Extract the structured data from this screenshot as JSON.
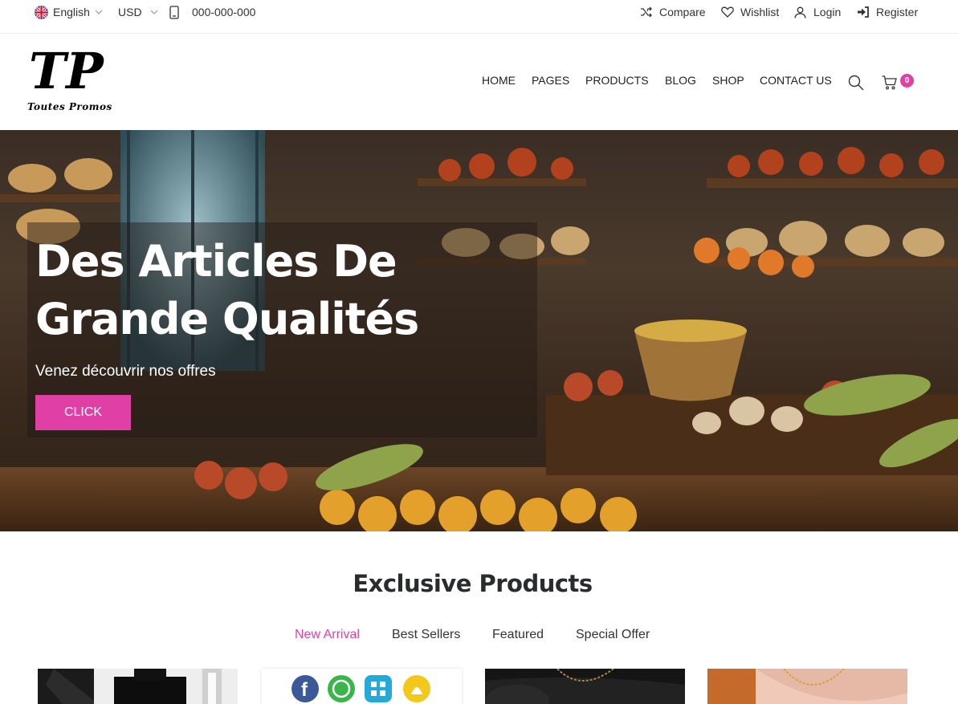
{
  "topbar": {
    "language": "English",
    "currency": "USD",
    "phone": "000-000-000",
    "compare": "Compare",
    "wishlist": "Wishlist",
    "login": "Login",
    "register": "Register"
  },
  "header": {
    "logo_mark": "TP",
    "logo_text": "Toutes Promos",
    "nav": [
      "HOME",
      "PAGES",
      "PRODUCTS",
      "BLOG",
      "SHOP",
      "CONTACT US"
    ],
    "cart_count": "0"
  },
  "hero": {
    "title_line1": "Des Articles De",
    "title_line2": "Grande Qualités",
    "subtitle": "Venez découvrir nos offres",
    "button": "CLICK"
  },
  "products": {
    "title": "Exclusive Products",
    "tabs": [
      "New Arrival",
      "Best Sellers",
      "Featured",
      "Special Offer"
    ],
    "active_tab": "New Arrival"
  },
  "colors": {
    "accent": "#e040a6",
    "text": "#292b2c"
  },
  "icons": [
    "uk-flag-icon",
    "chevron-down-icon",
    "mobile-phone-icon",
    "shuffle-icon",
    "heart-icon",
    "user-icon",
    "sign-in-icon",
    "search-icon",
    "cart-icon",
    "facebook-icon",
    "whatsapp-icon",
    "app-grid-icon",
    "snapchat-icon"
  ]
}
